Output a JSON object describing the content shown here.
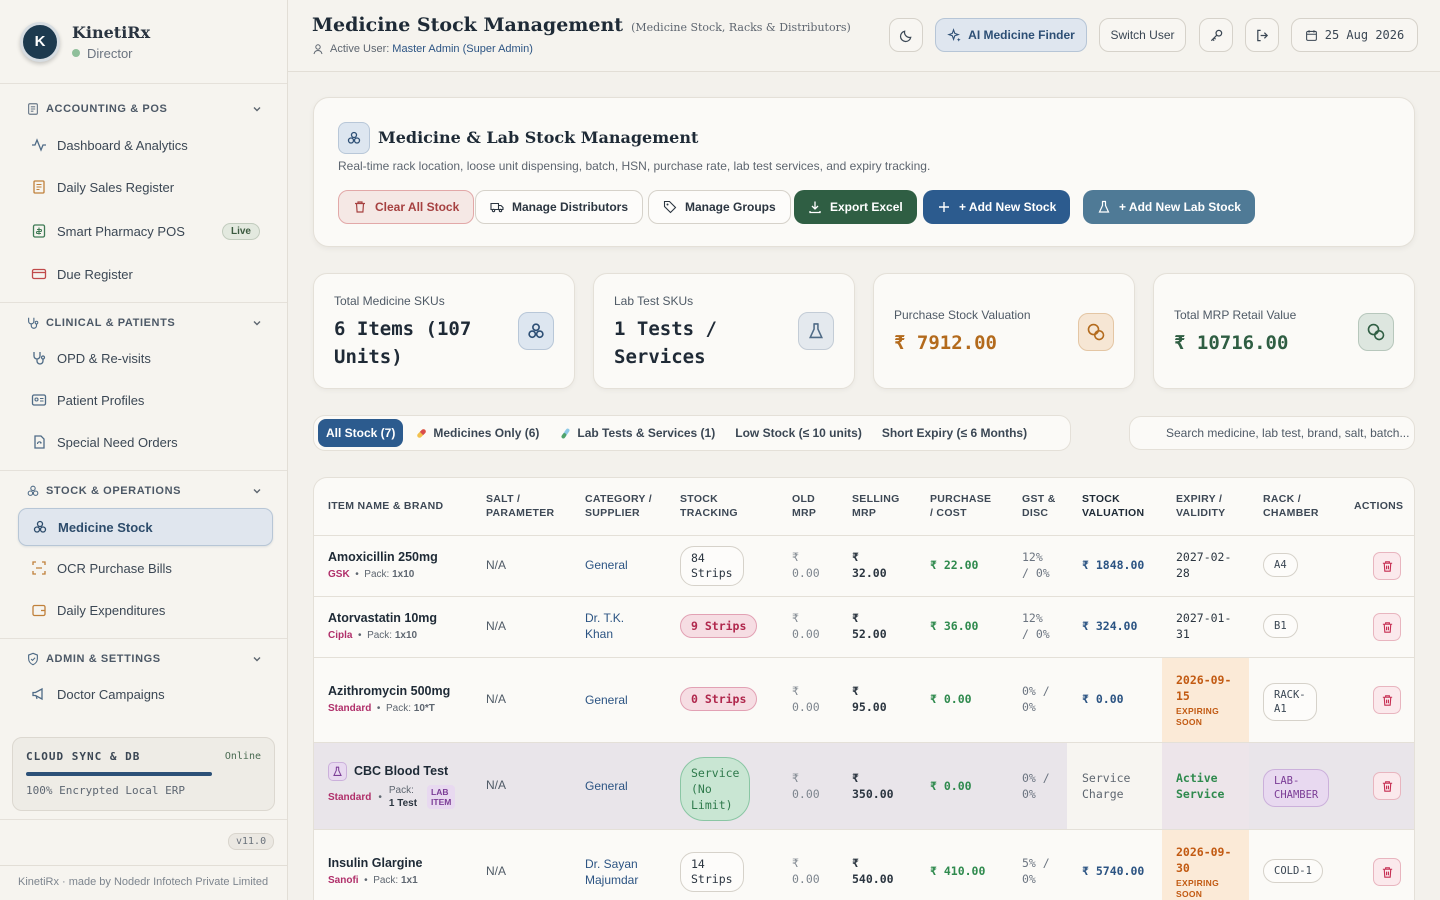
{
  "sidebar": {
    "brand_name": "KinetiRx",
    "brand_role": "Director",
    "logo_text": "K",
    "sections": [
      {
        "label": "ACCOUNTING & POS"
      },
      {
        "label": "CLINICAL & PATIENTS"
      },
      {
        "label": "STOCK & OPERATIONS"
      },
      {
        "label": "ADMIN & SETTINGS"
      }
    ],
    "items": {
      "dashboard": "Dashboard & Analytics",
      "daily_sales": "Daily Sales Register",
      "pos": "Smart Pharmacy POS",
      "pos_badge": "Live",
      "due": "Due Register",
      "opd": "OPD & Re-visits",
      "patients": "Patient Profiles",
      "special": "Special Need Orders",
      "medicine_stock": "Medicine Stock",
      "ocr": "OCR Purchase Bills",
      "expenditures": "Daily Expenditures",
      "campaigns": "Doctor Campaigns"
    },
    "sync": {
      "title": "CLOUD SYNC & DB",
      "status": "Online",
      "note": "100% Encrypted Local ERP",
      "progress": 0.79
    },
    "version": "v11.0",
    "footer": "KinetiRx · made by Nodedr Infotech Private Limited"
  },
  "header": {
    "title": "Medicine Stock Management",
    "subtitle": "(Medicine Stock, Racks & Distributors)",
    "active_user_label": "Active User:",
    "active_user": "Master Admin (Super Admin)",
    "ai_button": "AI Medicine Finder",
    "switch_user": "Switch User",
    "date": "25 Aug 2026"
  },
  "hero": {
    "title": "Medicine & Lab Stock Management",
    "subtitle": "Real-time rack location, loose unit dispensing, batch, HSN, purchase rate, lab test services, and expiry tracking.",
    "buttons": {
      "clear": "Clear All Stock",
      "distributors": "Manage Distributors",
      "groups": "Manage Groups",
      "export": "Export Excel",
      "add_stock": "+ Add New Stock",
      "add_lab": "+ Add New Lab Stock"
    }
  },
  "stats": [
    {
      "label": "Total Medicine SKUs",
      "value": "6 Items (107 Units)"
    },
    {
      "label": "Lab Test SKUs",
      "value": "1 Tests / Services"
    },
    {
      "label": "Purchase Stock Valuation",
      "value": "₹ 7912.00"
    },
    {
      "label": "Total MRP Retail Value",
      "value": "₹ 10716.00"
    }
  ],
  "filters": {
    "all": "All Stock (7)",
    "medicines": "Medicines Only (6)",
    "lab": "Lab Tests & Services (1)",
    "low": "Low Stock (≤ 10 units)",
    "expiry": "Short Expiry (≤ 6 Months)"
  },
  "search": {
    "placeholder": "Search medicine, lab test, brand, salt, batch..."
  },
  "table": {
    "headers": {
      "name": "ITEM NAME & BRAND",
      "salt": [
        "SALT /",
        "PARAMETER"
      ],
      "category": [
        "CATEGORY /",
        "SUPPLIER"
      ],
      "stock": [
        "STOCK",
        "TRACKING"
      ],
      "old_mrp": [
        "OLD",
        "MRP"
      ],
      "selling": [
        "SELLING",
        "MRP"
      ],
      "purchase": [
        "PURCHASE",
        "/ COST"
      ],
      "gst": [
        "GST &",
        "DISC"
      ],
      "valuation": [
        "STOCK",
        "VALUATION"
      ],
      "expiry": [
        "EXPIRY /",
        "VALIDITY"
      ],
      "rack": [
        "RACK /",
        "CHAMBER"
      ],
      "actions": "ACTIONS"
    },
    "pack_label": "Pack:",
    "rows": [
      {
        "name": "Amoxicillin 250mg",
        "brand": "GSK",
        "pack": "1x10",
        "salt": "N/A",
        "category": "General",
        "stock": [
          "84",
          "Strips"
        ],
        "old_mrp": [
          "₹",
          "0.00"
        ],
        "selling": [
          "₹",
          "32.00"
        ],
        "purchase": "₹ 22.00",
        "gst": [
          "12%",
          "/ 0%"
        ],
        "valuation": "₹ 1848.00",
        "expiry": [
          "2027-02-",
          "28"
        ],
        "rack": "A4"
      },
      {
        "name": "Atorvastatin 10mg",
        "brand": "Cipla",
        "pack": "1x10",
        "salt": "N/A",
        "category": [
          "Dr. T.K.",
          "Khan"
        ],
        "stock": "9 Strips",
        "old_mrp": [
          "₹",
          "0.00"
        ],
        "selling": [
          "₹",
          "52.00"
        ],
        "purchase": "₹ 36.00",
        "gst": [
          "12%",
          "/ 0%"
        ],
        "valuation": "₹ 324.00",
        "expiry": [
          "2027-01-",
          "31"
        ],
        "rack": "B1"
      },
      {
        "name": "Azithromycin 500mg",
        "brand": "Standard",
        "pack": "10*T",
        "salt": "N/A",
        "category": "General",
        "stock": "0 Strips",
        "old_mrp": [
          "₹",
          "0.00"
        ],
        "selling": [
          "₹",
          "95.00"
        ],
        "purchase": "₹ 0.00",
        "gst": [
          "0% /",
          "0%"
        ],
        "valuation": "₹ 0.00",
        "expiry": [
          "2026-09-",
          "15"
        ],
        "expiry_flag": [
          "EXPIRING",
          "SOON"
        ],
        "rack": [
          "RACK-",
          "A1"
        ]
      },
      {
        "name": "CBC Blood Test",
        "brand": "Standard",
        "pack_label": "Pack:",
        "pack": "1 Test",
        "lab_chip": [
          "LAB",
          "ITEM"
        ],
        "salt": "N/A",
        "category": "General",
        "stock": [
          "Service",
          "(No",
          "Limit)"
        ],
        "old_mrp": [
          "₹",
          "0.00"
        ],
        "selling": [
          "₹",
          "350.00"
        ],
        "purchase": "₹ 0.00",
        "gst": [
          "0% /",
          "0%"
        ],
        "valuation": [
          "Service",
          "Charge"
        ],
        "expiry": [
          "Active",
          "Service"
        ],
        "rack": [
          "LAB-",
          "CHAMBER"
        ]
      },
      {
        "name": "Insulin Glargine",
        "brand": "Sanofi",
        "pack": "1x1",
        "salt": "N/A",
        "category": [
          "Dr. Sayan",
          "Majumdar"
        ],
        "stock": [
          "14",
          "Strips"
        ],
        "old_mrp": [
          "₹",
          "0.00"
        ],
        "selling": [
          "₹",
          "540.00"
        ],
        "purchase": "₹ 410.00",
        "gst": [
          "5% /",
          "0%"
        ],
        "valuation": "₹ 5740.00",
        "expiry": [
          "2026-09-",
          "30"
        ],
        "expiry_flag": [
          "EXPIRING",
          "SOON"
        ],
        "rack": "COLD-1"
      }
    ]
  },
  "colors": {
    "primary": "#2c5b8e",
    "green": "#2f5e43",
    "danger": "#a64141",
    "background": "#f3f1ec"
  }
}
